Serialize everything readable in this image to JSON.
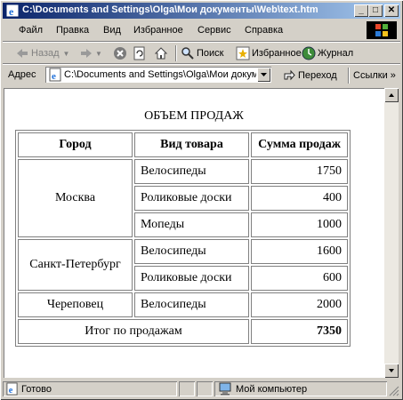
{
  "window": {
    "title": "C:\\Documents and Settings\\Olga\\Мои документы\\Web\\text.htm",
    "minimize": "_",
    "maximize": "□",
    "close": "✕"
  },
  "menu": [
    "Файл",
    "Правка",
    "Вид",
    "Избранное",
    "Сервис",
    "Справка"
  ],
  "toolbar": {
    "back": "Назад",
    "search": "Поиск",
    "favorites": "Избранное",
    "history": "Журнал"
  },
  "address": {
    "label": "Адрес",
    "value": "C:\\Documents and Settings\\Olga\\Мои документы\\Web\\text.htm",
    "go": "Переход",
    "links": "Ссылки",
    "links_arrow": "»"
  },
  "page": {
    "heading": "ОБЪЕМ ПРОДАЖ",
    "columns": [
      "Город",
      "Вид товара",
      "Сумма продаж"
    ],
    "groups": [
      {
        "city": "Москва",
        "rows": [
          {
            "product": "Велосипеды",
            "amount": "1750"
          },
          {
            "product": "Роликовые доски",
            "amount": "400"
          },
          {
            "product": "Мопеды",
            "amount": "1000"
          }
        ]
      },
      {
        "city": "Санкт-Петербург",
        "rows": [
          {
            "product": "Велосипеды",
            "amount": "1600"
          },
          {
            "product": "Роликовые доски",
            "amount": "600"
          }
        ]
      },
      {
        "city": "Череповец",
        "rows": [
          {
            "product": "Велосипеды",
            "amount": "2000"
          }
        ]
      }
    ],
    "total_label": "Итог по продажам",
    "total_value": "7350"
  },
  "status": {
    "left": "Готово",
    "zone": "Мой компьютер"
  },
  "colors": {
    "titlebar_start": "#0a246a",
    "titlebar_end": "#a6caf0",
    "chrome": "#d4d0c8"
  }
}
